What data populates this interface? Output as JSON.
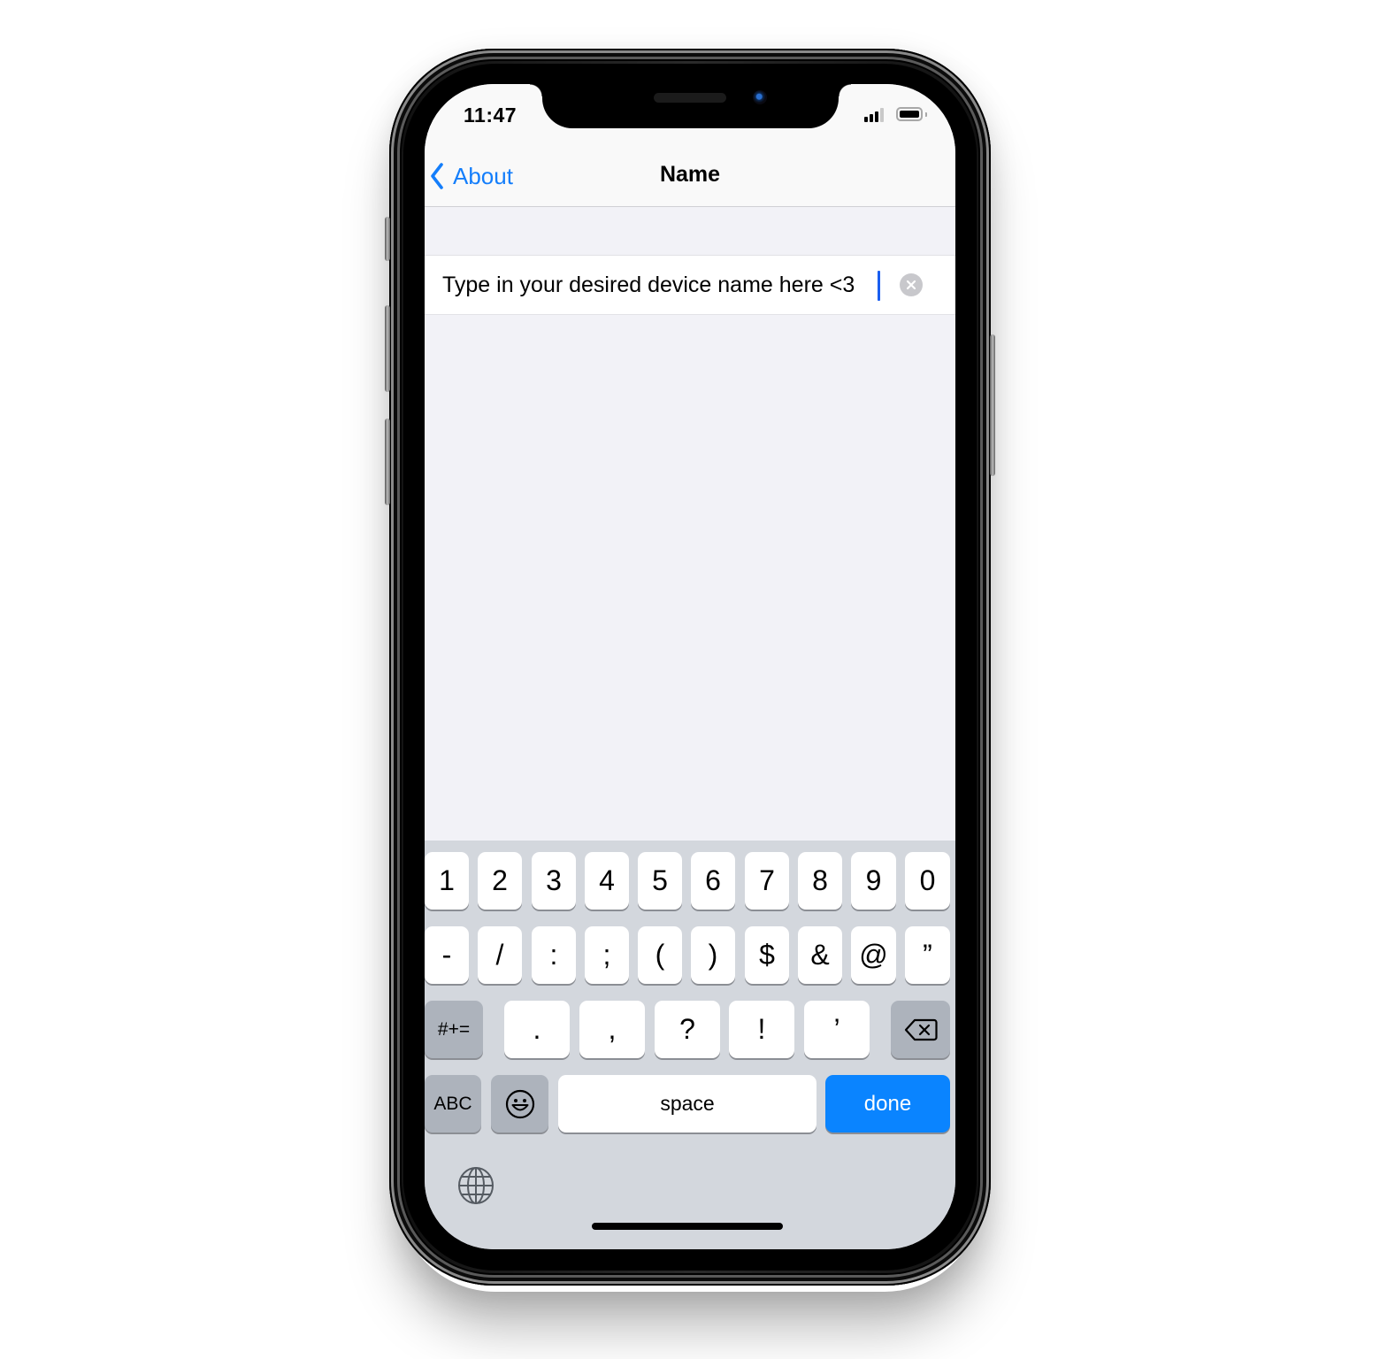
{
  "status_bar": {
    "time": "11:47",
    "signal_bars_active": 3,
    "signal_bars_total": 4,
    "battery_level": 0.9
  },
  "nav": {
    "back_label": "About",
    "title": "Name"
  },
  "name_field": {
    "value": "Type in your desired device name here <3",
    "placeholder": ""
  },
  "keyboard": {
    "row1": [
      "1",
      "2",
      "3",
      "4",
      "5",
      "6",
      "7",
      "8",
      "9",
      "0"
    ],
    "row2": [
      "-",
      "/",
      ":",
      ";",
      "(",
      ")",
      "$",
      "&",
      "@",
      "”"
    ],
    "row3": [
      ".",
      ",",
      "?",
      "!",
      "’"
    ],
    "symbols_toggle": "#+=",
    "abc_toggle": "ABC",
    "space_label": "space",
    "done_label": "done",
    "accent_color": "#0a84ff"
  },
  "colors": {
    "link_blue": "#147efb",
    "background": "#f2f2f7",
    "keyboard_bg": "#d3d7dd"
  }
}
